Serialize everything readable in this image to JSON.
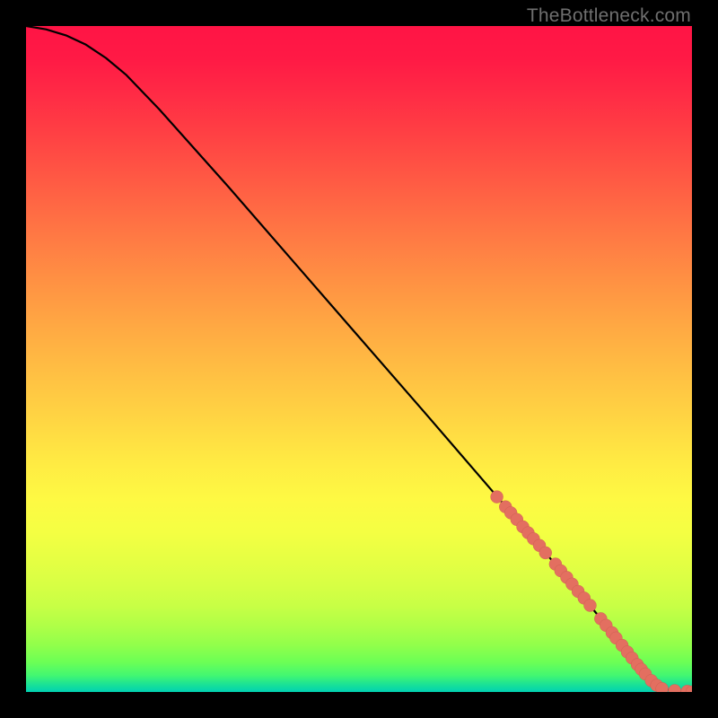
{
  "attribution": "TheBottleneck.com",
  "colors": {
    "curve": "#000000",
    "marker_fill": "#e36f60",
    "marker_stroke": "#c95c4e",
    "bg": "#000000"
  },
  "chart_data": {
    "type": "line",
    "title": "",
    "xlabel": "",
    "ylabel": "",
    "xlim": [
      0,
      100
    ],
    "ylim": [
      0,
      100
    ],
    "series": [
      {
        "name": "curve",
        "x": [
          0,
          3,
          6,
          9,
          12,
          15,
          20,
          30,
          40,
          50,
          60,
          70,
          78,
          82,
          85,
          88,
          90,
          92,
          94,
          96,
          98,
          100
        ],
        "y": [
          100,
          99.5,
          98.6,
          97.2,
          95.2,
          92.7,
          87.5,
          76.3,
          64.8,
          53.3,
          41.8,
          30.2,
          20.9,
          16.2,
          12.6,
          8.9,
          6.4,
          3.9,
          1.6,
          0.4,
          0.1,
          0
        ]
      }
    ],
    "markers": [
      {
        "x": 70.7,
        "y": 29.3
      },
      {
        "x": 72.0,
        "y": 27.8
      },
      {
        "x": 72.8,
        "y": 26.9
      },
      {
        "x": 73.7,
        "y": 25.9
      },
      {
        "x": 74.6,
        "y": 24.8
      },
      {
        "x": 75.4,
        "y": 23.9
      },
      {
        "x": 76.2,
        "y": 23.0
      },
      {
        "x": 77.1,
        "y": 22.0
      },
      {
        "x": 78.0,
        "y": 20.9
      },
      {
        "x": 79.5,
        "y": 19.2
      },
      {
        "x": 80.3,
        "y": 18.2
      },
      {
        "x": 81.2,
        "y": 17.2
      },
      {
        "x": 82.0,
        "y": 16.2
      },
      {
        "x": 82.9,
        "y": 15.1
      },
      {
        "x": 83.8,
        "y": 14.1
      },
      {
        "x": 84.7,
        "y": 13.0
      },
      {
        "x": 86.3,
        "y": 11.0
      },
      {
        "x": 87.1,
        "y": 10.0
      },
      {
        "x": 88.0,
        "y": 8.9
      },
      {
        "x": 88.6,
        "y": 8.1
      },
      {
        "x": 89.5,
        "y": 7.0
      },
      {
        "x": 90.3,
        "y": 6.0
      },
      {
        "x": 91.0,
        "y": 5.1
      },
      {
        "x": 91.8,
        "y": 4.1
      },
      {
        "x": 92.4,
        "y": 3.4
      },
      {
        "x": 93.0,
        "y": 2.7
      },
      {
        "x": 93.9,
        "y": 1.7
      },
      {
        "x": 94.7,
        "y": 1.0
      },
      {
        "x": 95.5,
        "y": 0.5
      },
      {
        "x": 97.4,
        "y": 0.2
      },
      {
        "x": 99.3,
        "y": 0.1
      },
      {
        "x": 100.0,
        "y": 0.0
      }
    ],
    "marker_radius": 7
  }
}
